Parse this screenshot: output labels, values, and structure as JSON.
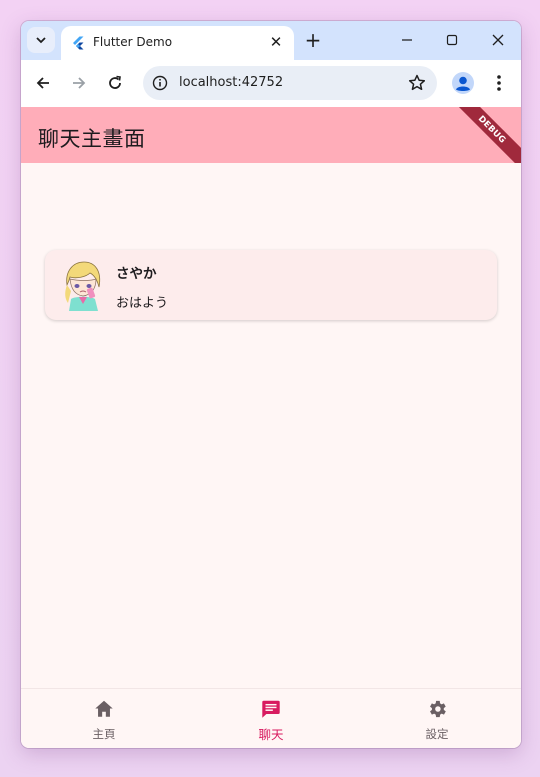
{
  "browser": {
    "tab_title": "Flutter Demo",
    "tab_close": "✕",
    "new_tab": "+",
    "url": "localhost:42752"
  },
  "app": {
    "title": "聊天主畫面",
    "debug_banner": "DEBUG",
    "accent_color": "#d81b60",
    "appbar_color": "#ffadb9"
  },
  "chats": [
    {
      "name": "さやか",
      "message": "おはよう"
    }
  ],
  "bottom_nav": [
    {
      "label": "主頁",
      "icon": "home-icon",
      "active": false
    },
    {
      "label": "聊天",
      "icon": "chat-icon",
      "active": true
    },
    {
      "label": "設定",
      "icon": "settings-icon",
      "active": false
    }
  ]
}
